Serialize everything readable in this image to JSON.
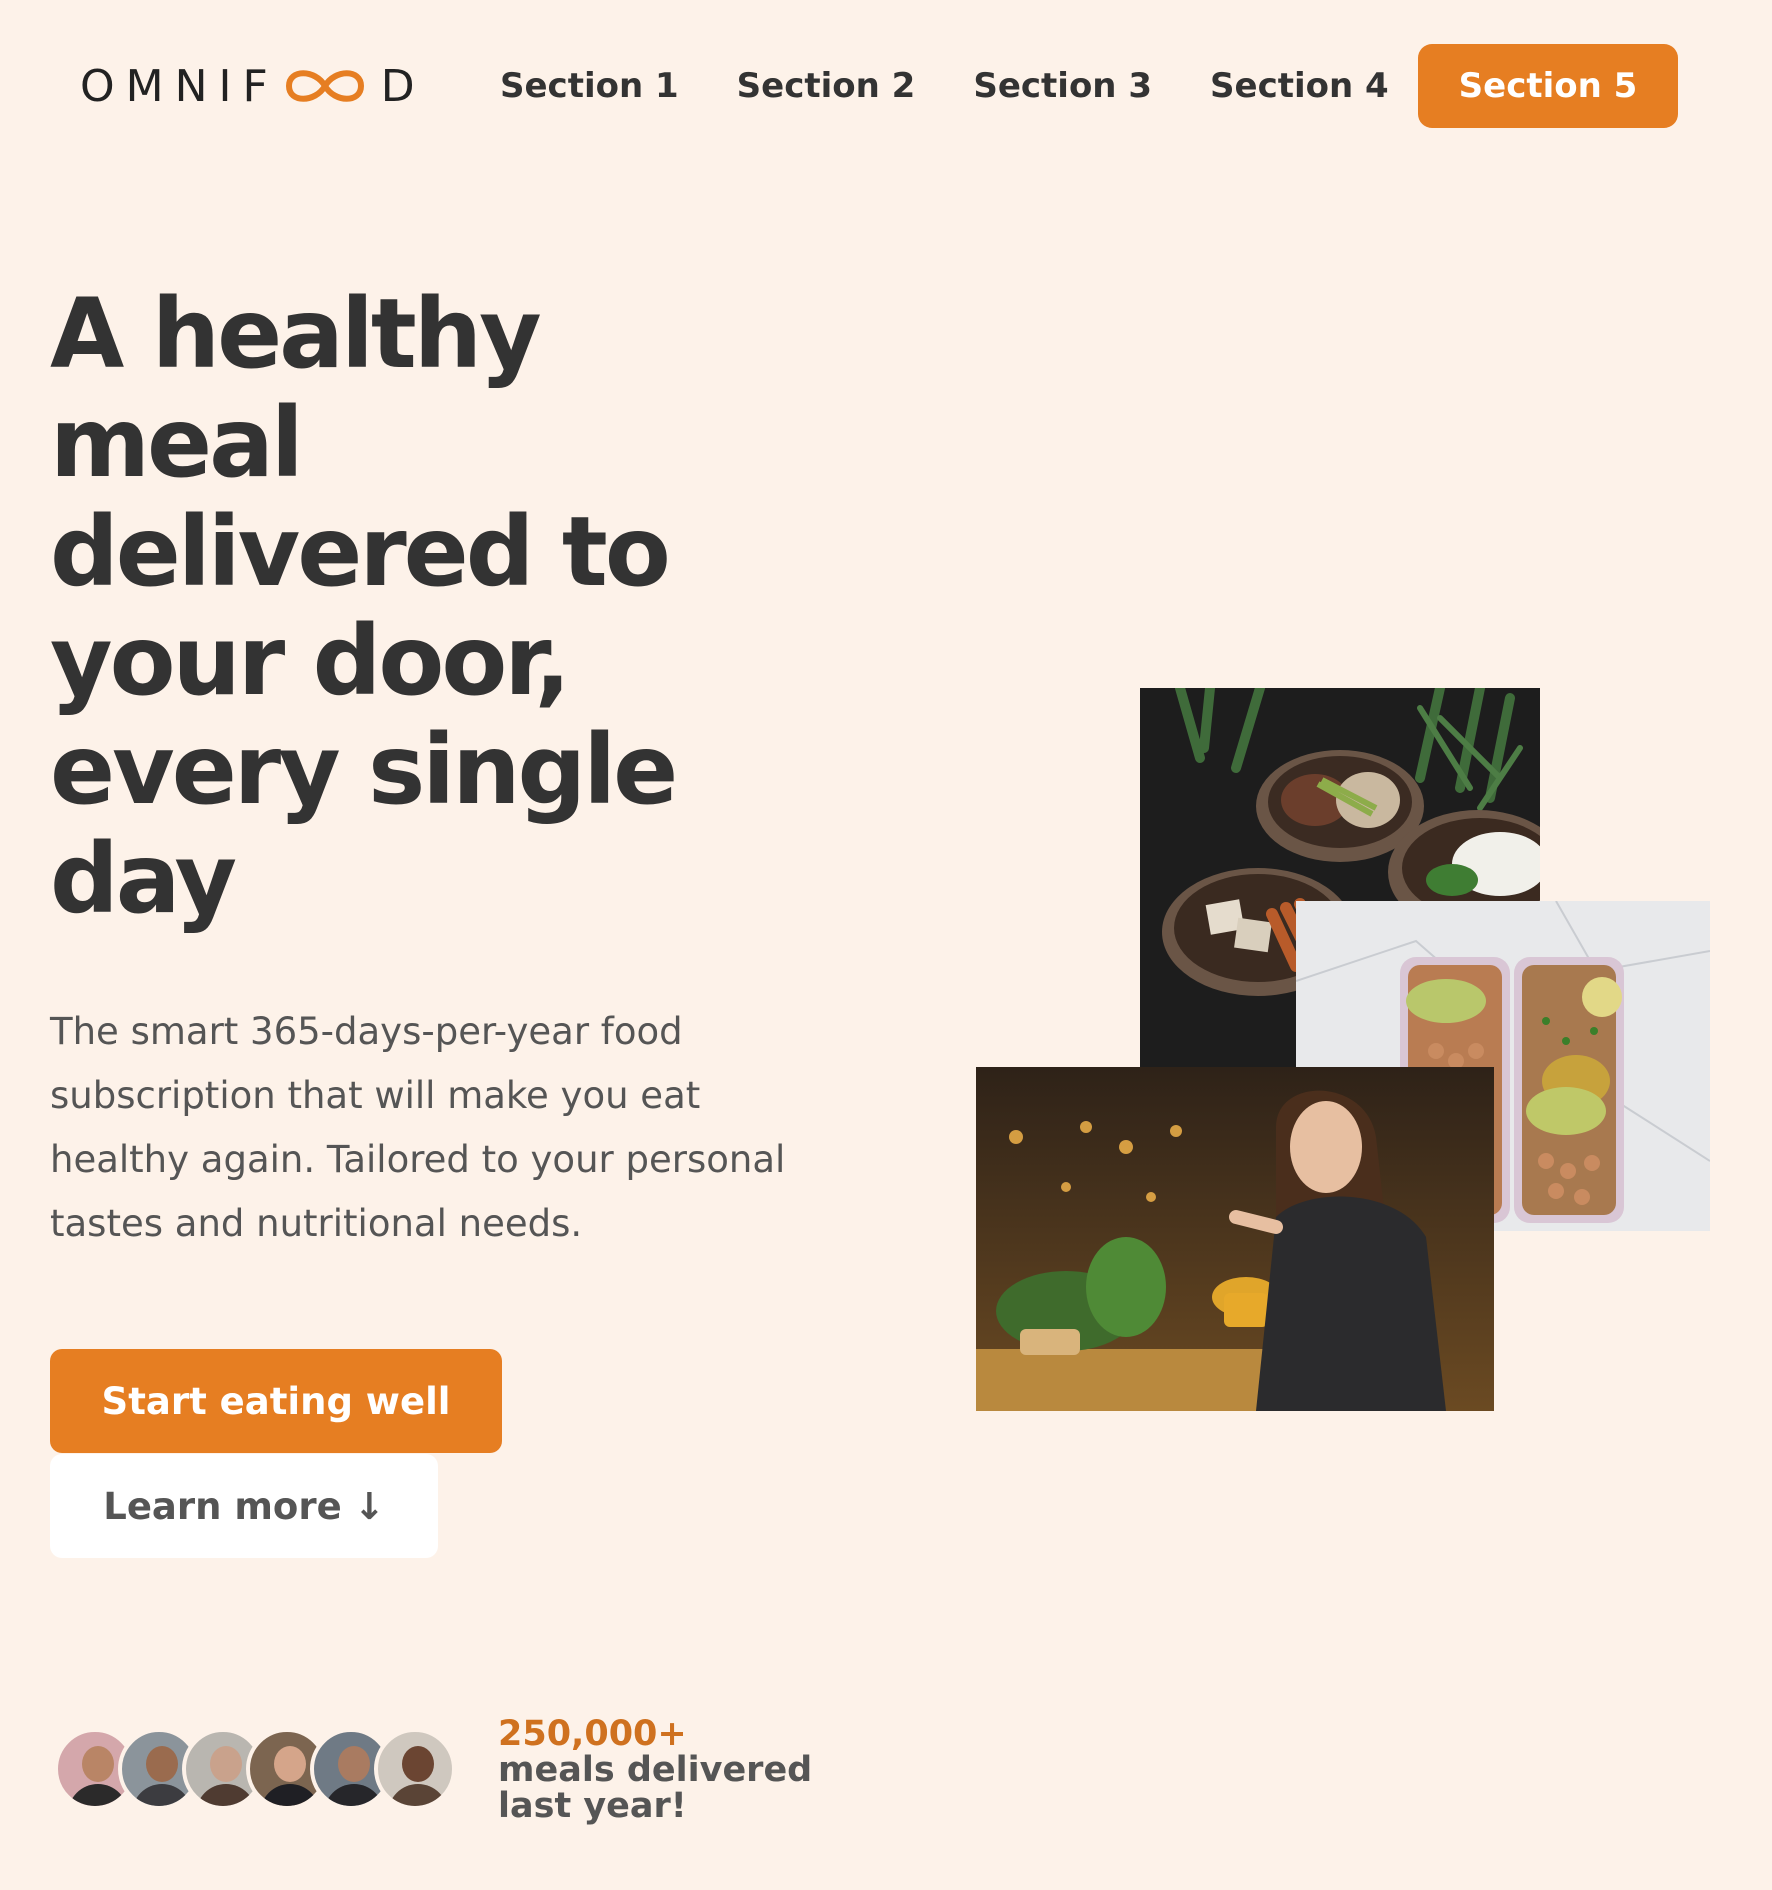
{
  "header": {
    "logo_text_left": "OMNIF",
    "logo_text_right": "D",
    "logo_icon": "infinity-icon",
    "nav": [
      {
        "label": "Section 1"
      },
      {
        "label": "Section 2"
      },
      {
        "label": "Section 3"
      },
      {
        "label": "Section 4"
      }
    ],
    "cta_label": "Section 5"
  },
  "hero": {
    "title": "A healthy meal delivered to your door, every single day",
    "description": "The smart 365-days-per-year food subscription that will make you eat healthy again. Tailored to your personal tastes and nutritional needs.",
    "primary_button": "Start eating well",
    "secondary_button": "Learn more",
    "secondary_icon": "↓"
  },
  "customers": {
    "count": "250,000+",
    "line1": "meals delivered",
    "line2": "last year!"
  },
  "images": [
    {
      "name": "food bowls photo"
    },
    {
      "name": "meal prep boxes photo"
    },
    {
      "name": "woman eating photo"
    }
  ],
  "colors": {
    "background": "#fdf2e9",
    "accent": "#e67e22",
    "text": "#333333"
  }
}
